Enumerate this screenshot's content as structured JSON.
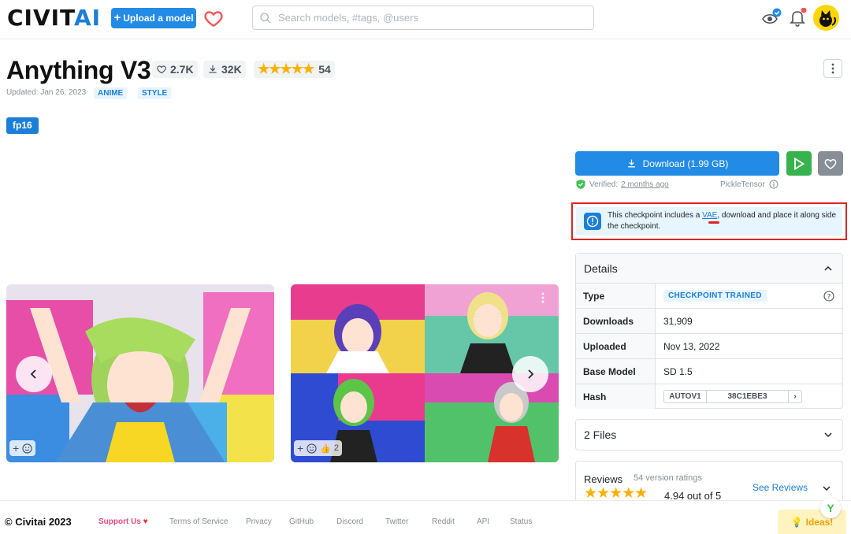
{
  "header": {
    "logo_main": "CIVIT",
    "logo_accent": "AI",
    "upload_label": "Upload a model",
    "search_placeholder": "Search models, #tags, @users"
  },
  "model": {
    "title": "Anything V3",
    "likes": "2.7K",
    "downloads": "32K",
    "rating_count": "54",
    "updated": "Updated: Jan 26, 2023",
    "tags": [
      "ANIME",
      "STYLE"
    ],
    "version_badge": "fp16"
  },
  "download": {
    "label": "Download (1.99 GB)",
    "verified_prefix": "Verified:",
    "verified_when": "2 months ago",
    "scanner": "PickleTensor"
  },
  "alert": {
    "before": "This checkpoint includes a ",
    "link": "VAE",
    "after": ", download and place it along side the checkpoint."
  },
  "details": {
    "heading": "Details",
    "rows": [
      {
        "key": "Type",
        "value": "CHECKPOINT TRAINED"
      },
      {
        "key": "Downloads",
        "value": "31,909"
      },
      {
        "key": "Uploaded",
        "value": "Nov 13, 2022"
      },
      {
        "key": "Base Model",
        "value": "SD 1.5"
      },
      {
        "key": "Hash",
        "value": "38C1EBE3"
      }
    ],
    "hash_type": "AUTOV1"
  },
  "files": {
    "label": "2 Files"
  },
  "reviews": {
    "heading": "Reviews",
    "count": "54 version ratings",
    "see_label": "See Reviews",
    "score": "4.94 out of 5"
  },
  "gallery": {
    "reaction_count": "2"
  },
  "footer": {
    "copyright": "© Civitai 2023",
    "links": [
      "Support Us",
      "Terms of Service",
      "Privacy",
      "GitHub",
      "Discord",
      "Twitter",
      "Reddit",
      "API",
      "Status"
    ],
    "ideas_label": "Ideas!"
  },
  "colors": {
    "accent": "#228be6",
    "success": "#37b24d",
    "star": "#fab005",
    "alert_border": "#e02424"
  }
}
